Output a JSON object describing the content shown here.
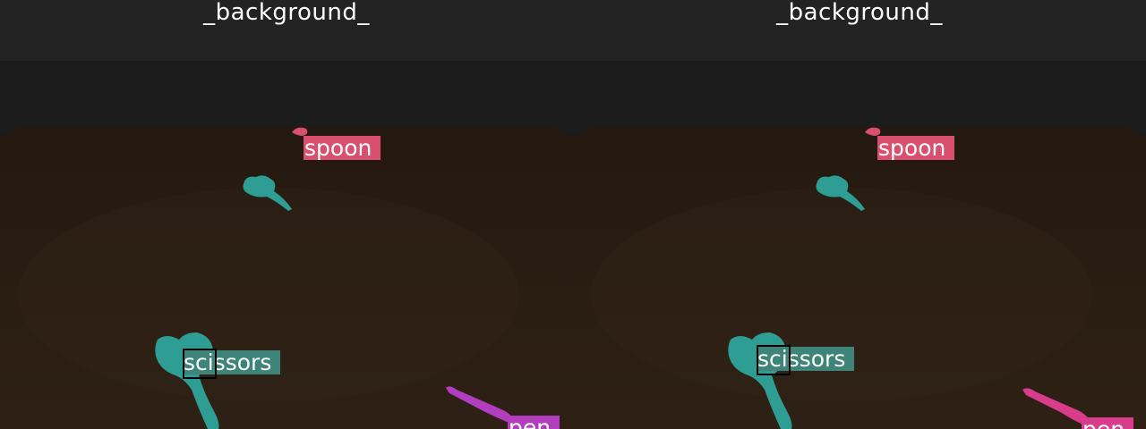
{
  "panels": [
    {
      "background_label": "_background_",
      "labels": {
        "spoon": "spoon",
        "scissors": "scissors",
        "pen": "pen"
      },
      "colors": {
        "spoon": "#d9506f",
        "scissors": "#3e8478",
        "pen": "#b23dbe"
      }
    },
    {
      "background_label": "_background_",
      "labels": {
        "spoon": "spoon",
        "scissors": "scissors",
        "pen": "pen"
      },
      "colors": {
        "spoon": "#d9506f",
        "scissors": "#3e8478",
        "pen": "#d83c8a"
      }
    }
  ],
  "colors": {
    "background_band": "#232323",
    "wall": "#1c1c1c",
    "floor": "#2a1c12",
    "object_mask_teal": "#2e9e94"
  }
}
